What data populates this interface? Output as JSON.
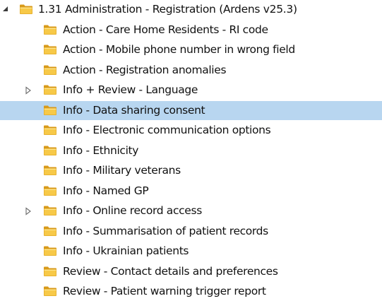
{
  "tree": {
    "root": {
      "label": "1.31 Administration - Registration (Ardens v25.3)",
      "expanded": true,
      "icon": "folder-icon"
    },
    "selected_index": 4,
    "items": [
      {
        "label": "Action - Care Home Residents - RI code",
        "has_children": false
      },
      {
        "label": "Action - Mobile phone number in wrong field",
        "has_children": false
      },
      {
        "label": "Action - Registration anomalies",
        "has_children": false
      },
      {
        "label": "Info + Review - Language",
        "has_children": true
      },
      {
        "label": "Info - Data sharing consent",
        "has_children": false
      },
      {
        "label": "Info - Electronic communication options",
        "has_children": false
      },
      {
        "label": "Info - Ethnicity",
        "has_children": false
      },
      {
        "label": "Info - Military veterans",
        "has_children": false
      },
      {
        "label": "Info - Named GP",
        "has_children": false
      },
      {
        "label": "Info - Online record access",
        "has_children": true
      },
      {
        "label": "Info - Summarisation of patient records",
        "has_children": false
      },
      {
        "label": "Info - Ukrainian patients",
        "has_children": false
      },
      {
        "label": "Review - Contact details and preferences",
        "has_children": false
      },
      {
        "label": "Review - Patient warning trigger report",
        "has_children": false
      }
    ]
  },
  "colors": {
    "selection": "#b8d6f0",
    "folder_body": "#f7c948",
    "folder_dark": "#d89a1a",
    "folder_light": "#ffe58a"
  }
}
